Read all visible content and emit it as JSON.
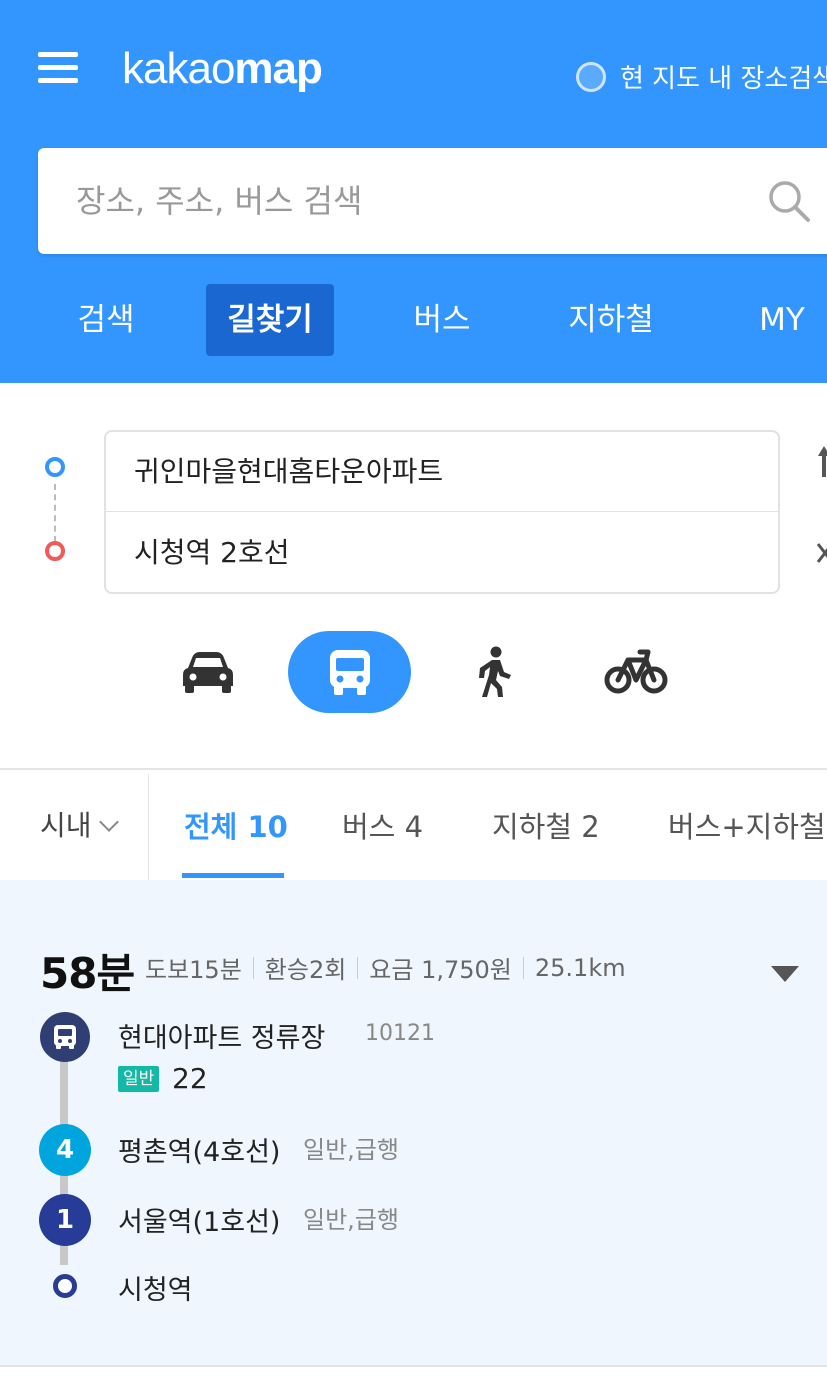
{
  "header": {
    "logo_light": "kakao",
    "logo_bold": "map",
    "map_search_label": "현 지도 내 장소검색",
    "search_placeholder": "장소, 주소, 버스 검색",
    "tabs": [
      {
        "label": "검색",
        "active": false
      },
      {
        "label": "길찾기",
        "active": true
      },
      {
        "label": "버스",
        "active": false
      },
      {
        "label": "지하철",
        "active": false
      },
      {
        "label": "MY",
        "active": false
      }
    ],
    "colors": {
      "brand": "#3396ff",
      "active_tab": "#1a67d2"
    }
  },
  "route": {
    "origin": "귀인마을현대홈타운아파트",
    "destination": "시청역 2호선"
  },
  "modes": [
    {
      "name": "car",
      "active": false
    },
    {
      "name": "transit",
      "active": true
    },
    {
      "name": "walk",
      "active": false
    },
    {
      "name": "bike",
      "active": false
    }
  ],
  "filters": {
    "region": "시내",
    "tabs": [
      {
        "label": "전체 10",
        "active": true
      },
      {
        "label": "버스 4",
        "active": false
      },
      {
        "label": "지하철 2",
        "active": false
      },
      {
        "label": "버스+지하철",
        "active": false
      }
    ]
  },
  "result": {
    "duration": "58분",
    "walk": "도보15분",
    "transfers": "환승2회",
    "fare": "요금 1,750원",
    "distance": "25.1km",
    "steps": [
      {
        "name": "현대아파트 정류장",
        "meta": "10121",
        "type": "bus",
        "badge": "일반",
        "bus_number": "22",
        "color": "#2f3f73"
      },
      {
        "name": "평촌역(4호선)",
        "meta": "일반,급행",
        "type": "subway",
        "line": "4",
        "color": "#00a5de"
      },
      {
        "name": "서울역(1호선)",
        "meta": "일반,급행",
        "type": "subway",
        "line": "1",
        "color": "#263c96"
      },
      {
        "name": "시청역",
        "meta": "",
        "type": "end",
        "color": "#263c96"
      }
    ]
  }
}
